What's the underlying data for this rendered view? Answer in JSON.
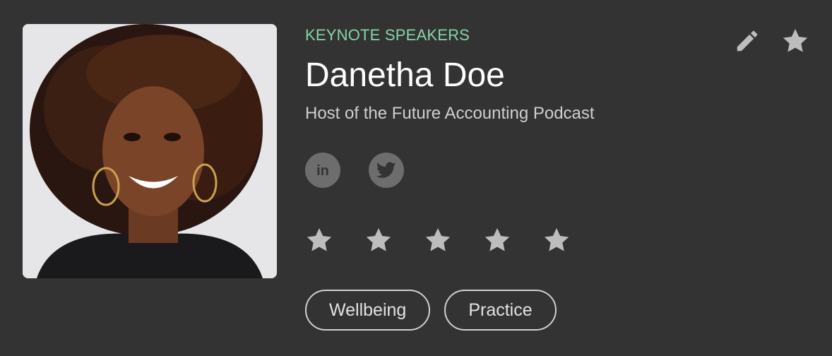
{
  "speaker": {
    "category": "KEYNOTE SPEAKERS",
    "name": "Danetha Doe",
    "title": "Host of the Future Accounting Podcast"
  },
  "social": [
    {
      "network": "linkedin",
      "icon": "linkedin-icon",
      "glyph": "in"
    },
    {
      "network": "twitter",
      "icon": "twitter-icon"
    }
  ],
  "rating": {
    "max": 5,
    "value": 0
  },
  "tags": [
    "Wellbeing",
    "Practice"
  ],
  "actions": {
    "edit_icon": "pencil-icon",
    "favorite_icon": "star-icon"
  },
  "colors": {
    "background": "#333333",
    "category": "#86d4a8",
    "name": "#ffffff",
    "subtitle": "#cfcfcf",
    "icon_gray": "#bdbdbd",
    "social_bg": "#6d6d6d",
    "social_fg": "#333333"
  }
}
